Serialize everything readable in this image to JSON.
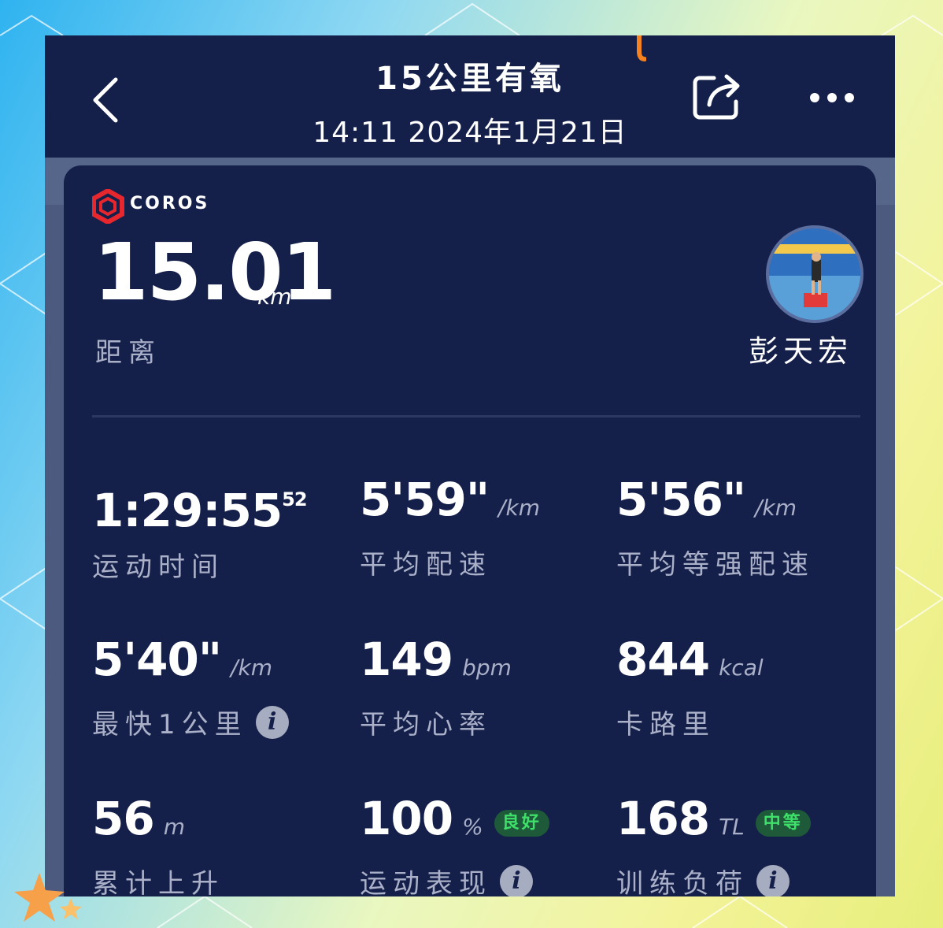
{
  "header": {
    "title": "15公里有氧",
    "datetime": "14:11 2024年1月21日"
  },
  "brand": {
    "logo_text": "COROS"
  },
  "distance": {
    "value": "15.01",
    "unit": "km",
    "label": "距离"
  },
  "user": {
    "name": "彭天宏"
  },
  "stats": [
    {
      "value": "1:29:55",
      "sup": "52",
      "unit": "",
      "label": "运动时间"
    },
    {
      "value": "5'59\"",
      "unit": "/km",
      "label": "平均配速"
    },
    {
      "value": "5'56\"",
      "unit": "/km",
      "label": "平均等强配速"
    },
    {
      "value": "5'40\"",
      "unit": "/km",
      "label": "最快1公里"
    },
    {
      "value": "149",
      "unit": "bpm",
      "label": "平均心率"
    },
    {
      "value": "844",
      "unit": "kcal",
      "label": "卡路里"
    },
    {
      "value": "56",
      "unit": "m",
      "label": "累计上升"
    },
    {
      "value": "100",
      "unit": "%",
      "badge": "良好",
      "label": "运动表现"
    },
    {
      "value": "168",
      "unit": "TL",
      "badge": "中等",
      "label": "训练负荷"
    }
  ],
  "info_glyph": "i",
  "icons": [
    "back-arrow-icon",
    "share-icon",
    "more-icon",
    "coros-logo-icon",
    "info-icon"
  ],
  "colors": {
    "card": "#15204a",
    "accent": "#e8262e",
    "badge_text": "#3ee06a"
  }
}
